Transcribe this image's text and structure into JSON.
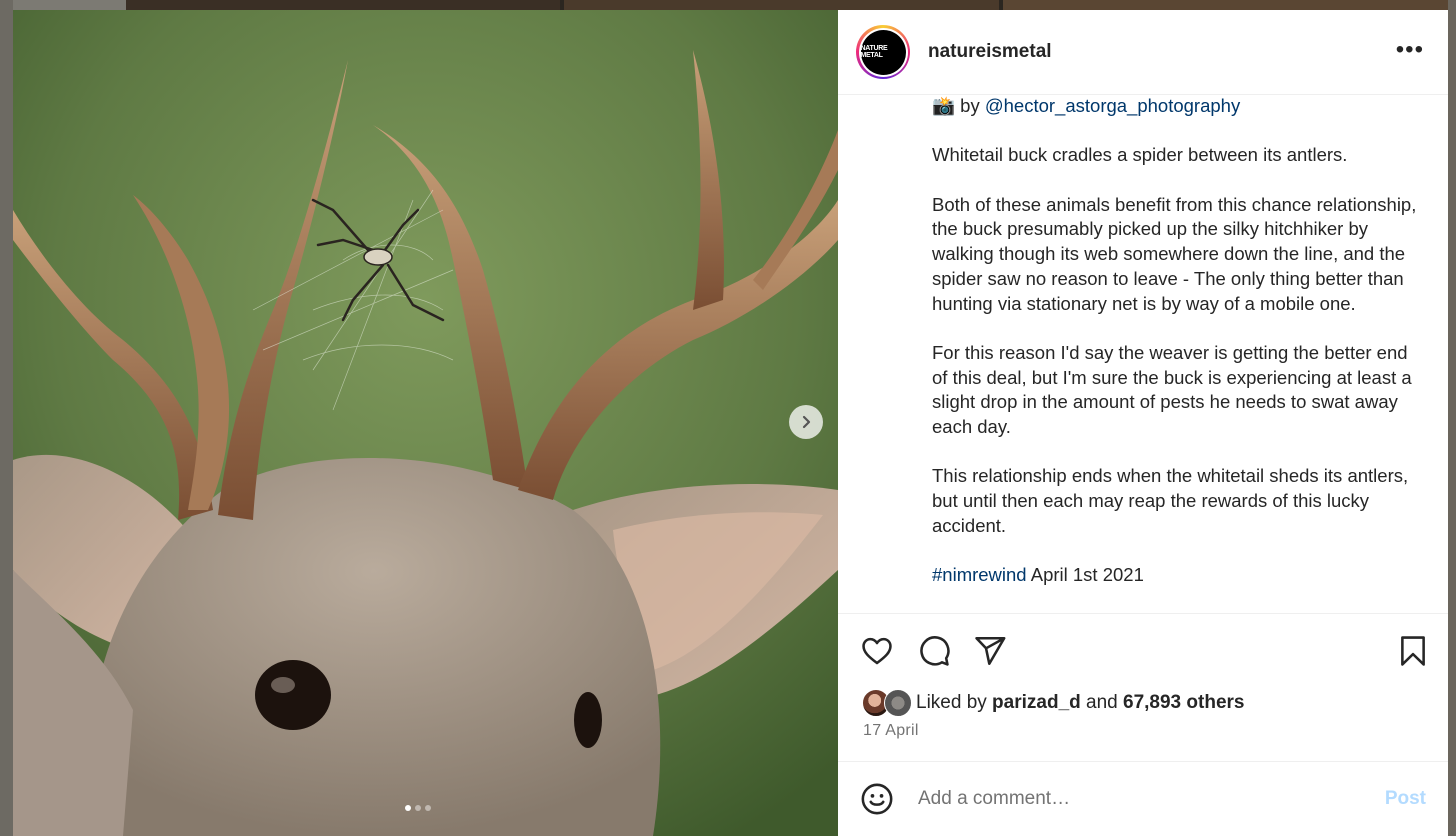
{
  "post": {
    "username": "natureismetal",
    "avatar_text": "NATURE METAL",
    "more_label": "•••",
    "credit_prefix": "📸 by ",
    "credit_handle": "@hector_astorga_photography",
    "caption_paragraphs": [
      "Whitetail buck cradles a spider between its antlers.",
      "Both of these animals benefit from this chance relationship, the buck presumably picked up the silky hitchhiker by walking though its web somewhere down the line, and the spider saw no reason to leave - The only thing better than hunting via stationary net is by way of a mobile one.",
      "For this reason I'd say the weaver is getting the better end of this deal, but I'm sure the buck is experiencing at least a slight drop in the amount of pests he needs to swat away each day.",
      "This relationship ends when the whitetail sheds its antlers, but until then each may reap the rewards of this lucky accident."
    ],
    "hashtag": "#nimrewind",
    "hashtag_suffix": " April 1st 2021",
    "likes_prefix": "Liked by ",
    "liked_by_user": "parizad_d",
    "likes_and": " and ",
    "likes_others": "67,893 others",
    "date": "17 April",
    "comment_placeholder": "Add a comment…",
    "post_label": "Post",
    "carousel": {
      "count": 3,
      "active": 1
    }
  },
  "icons": [
    "heart-icon",
    "comment-icon",
    "share-icon",
    "bookmark-icon",
    "emoji-icon",
    "chevron-right-icon"
  ],
  "colors": {
    "link": "#00376b",
    "post_disabled": "#b3dbff",
    "muted": "#737373"
  }
}
